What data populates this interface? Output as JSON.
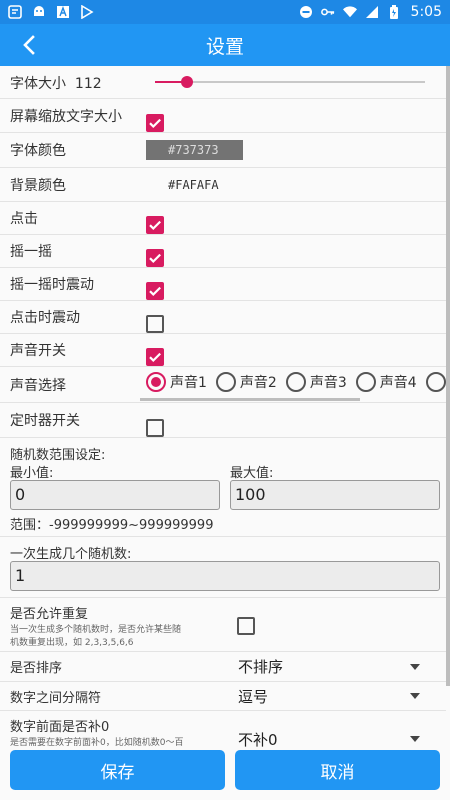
{
  "status": {
    "time": "5:05"
  },
  "appbar": {
    "title": "设置"
  },
  "settings": {
    "font_size": {
      "label": "字体大小",
      "value": "112",
      "level": 0.12
    },
    "screen_scale": {
      "label": "屏幕缩放文字大小",
      "checked": true
    },
    "font_color": {
      "label": "字体颜色",
      "value": "#737373"
    },
    "bg_color": {
      "label": "背景颜色",
      "value": "#FAFAFA"
    },
    "click": {
      "label": "点击",
      "checked": true
    },
    "shake": {
      "label": "摇一摇",
      "checked": true
    },
    "shake_vibrate": {
      "label": "摇一摇时震动",
      "checked": true
    },
    "click_vibrate": {
      "label": "点击时震动",
      "checked": false
    },
    "sound_switch": {
      "label": "声音开关",
      "checked": true
    },
    "sound_select": {
      "label": "声音选择",
      "options": [
        "声音1",
        "声音2",
        "声音3",
        "声音4"
      ],
      "selected": "声音1"
    },
    "timer_switch": {
      "label": "定时器开关",
      "checked": false
    },
    "range": {
      "title": "随机数范围设定:",
      "min_label": "最小值:",
      "max_label": "最大值:",
      "min_value": "0",
      "max_value": "100",
      "range_hint": "范围：-999999999~999999999"
    },
    "count": {
      "label": "一次生成几个随机数:",
      "value": "1"
    },
    "allow_repeat": {
      "label": "是否允许重复",
      "desc_line1": "当一次生成多个随机数时，是否允许某些随",
      "desc_line2": "机数重复出现，如 2,3,3,5,6,6",
      "checked": false
    },
    "sort": {
      "label": "是否排序",
      "value": "不排序"
    },
    "separator": {
      "label": "数字之间分隔符",
      "value": "逗号"
    },
    "pad_zero": {
      "label": "数字前面是否补0",
      "desc": "是否需要在数字前面补0，比如随机数0～百",
      "value": "不补0"
    }
  },
  "buttons": {
    "save": "保存",
    "cancel": "取消"
  },
  "colors": {
    "primary": "#2196f3",
    "statusbar": "#1e88e5",
    "accent": "#d81b60"
  }
}
